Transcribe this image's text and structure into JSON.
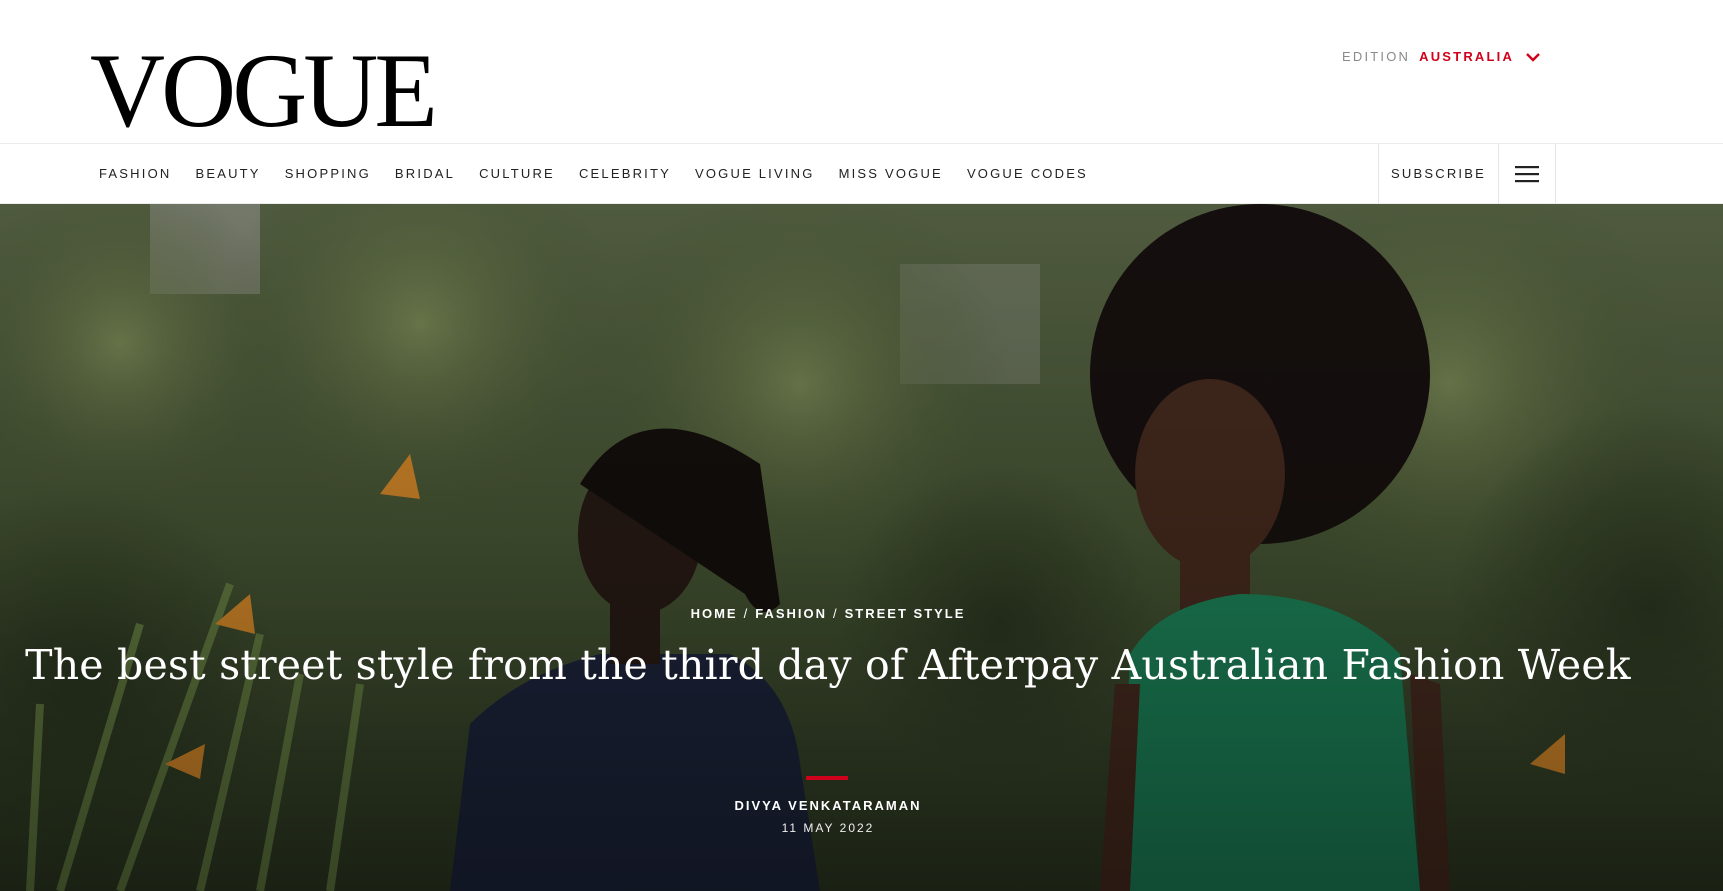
{
  "brand": {
    "logo_text": "VOGUE"
  },
  "edition": {
    "label": "EDITION",
    "value": "AUSTRALIA",
    "accent": "#d0021b"
  },
  "nav": {
    "items": [
      "FASHION",
      "BEAUTY",
      "SHOPPING",
      "BRIDAL",
      "CULTURE",
      "CELEBRITY",
      "VOGUE LIVING",
      "MISS VOGUE",
      "VOGUE CODES"
    ],
    "subscribe": "SUBSCRIBE",
    "menu_icon": "hamburger-icon"
  },
  "article": {
    "breadcrumb": [
      "HOME",
      "FASHION",
      "STREET STYLE"
    ],
    "breadcrumb_separator": "/",
    "title": "The best street style from the third day of Afterpay Australian Fashion Week",
    "author": "DIVYA VENKATARAMAN",
    "date": "11 MAY 2022"
  }
}
